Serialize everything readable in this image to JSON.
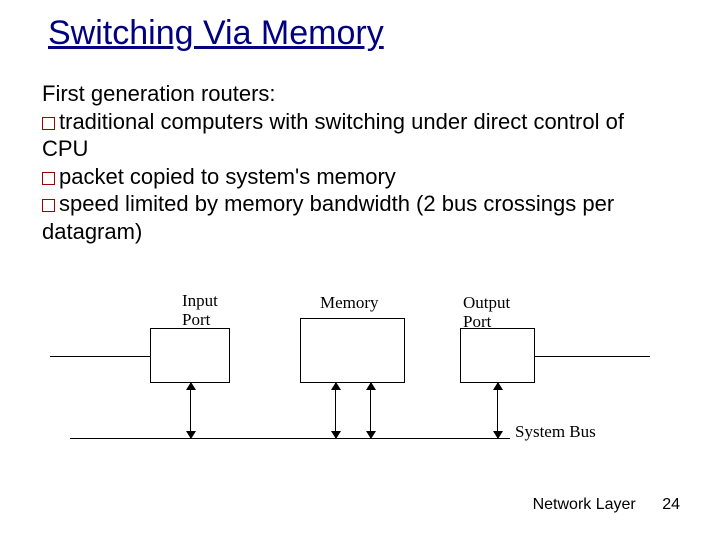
{
  "title": "Switching Via Memory",
  "body": {
    "intro": "First generation routers:",
    "bullets": [
      "traditional computers with switching under direct control of CPU",
      "packet copied to system's memory",
      "speed limited by memory bandwidth (2 bus crossings per datagram)"
    ]
  },
  "diagram": {
    "input_label_line1": "Input",
    "input_label_line2": "Port",
    "memory_label": "Memory",
    "output_label_line1": "Output",
    "output_label_line2": "Port",
    "bus_label": "System Bus"
  },
  "footer": {
    "section": "Network Layer",
    "page": "24"
  }
}
